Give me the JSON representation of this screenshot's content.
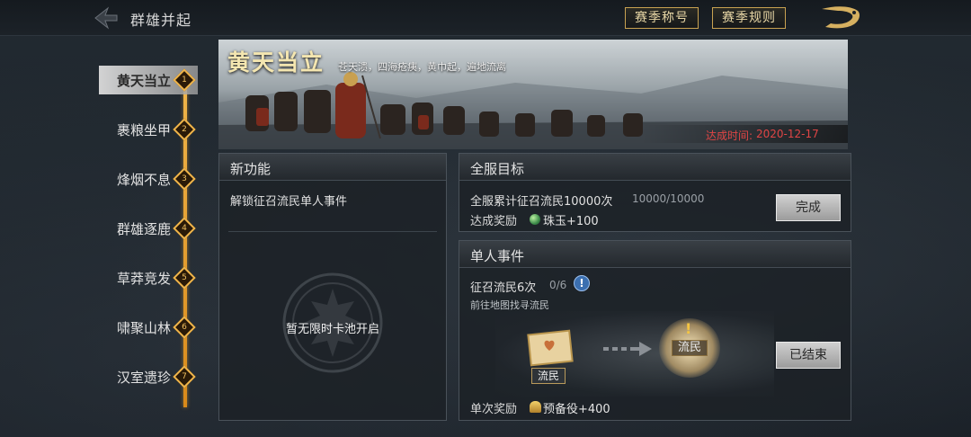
{
  "header": {
    "page_title": "群雄并起",
    "season_title_button": "赛季称号",
    "season_rules_button": "赛季规则"
  },
  "sidebar": {
    "items": [
      {
        "label": "黄天当立",
        "num": "1",
        "active": true
      },
      {
        "label": "裹粮坐甲",
        "num": "2",
        "active": false
      },
      {
        "label": "烽烟不息",
        "num": "3",
        "active": false
      },
      {
        "label": "群雄逐鹿",
        "num": "4",
        "active": false
      },
      {
        "label": "草莽竞发",
        "num": "5",
        "active": false
      },
      {
        "label": "啸聚山林",
        "num": "6",
        "active": false
      },
      {
        "label": "汉室遗珍",
        "num": "7",
        "active": false
      }
    ]
  },
  "banner": {
    "title": "黄天当立",
    "subtitle": "苍天溃，四海疮痍，黄巾起，遍地流离",
    "date_label": "达成时间:",
    "date": "2020-12-17"
  },
  "new_feature": {
    "title": "新功能",
    "item": "解锁征召流民单人事件",
    "empty_text": "暂无限时卡池开启"
  },
  "server_goal": {
    "title": "全服目标",
    "desc": "全服累计征召流民10000次",
    "progress": "10000/10000",
    "reward_label": "达成奖励",
    "reward": "珠玉+100",
    "button": "完成"
  },
  "single_event": {
    "title": "单人事件",
    "task": "征召流民6次",
    "progress": "0/6",
    "desc": "前往地图找寻流民",
    "scroll_tag": "流民",
    "refugee_tag": "流民",
    "reward_label": "单次奖励",
    "reward": "预备役+400",
    "button": "已结束"
  },
  "colors": {
    "accent_gold": "#f0b54a",
    "date_red": "#e04545",
    "bg": "#1d232a"
  }
}
